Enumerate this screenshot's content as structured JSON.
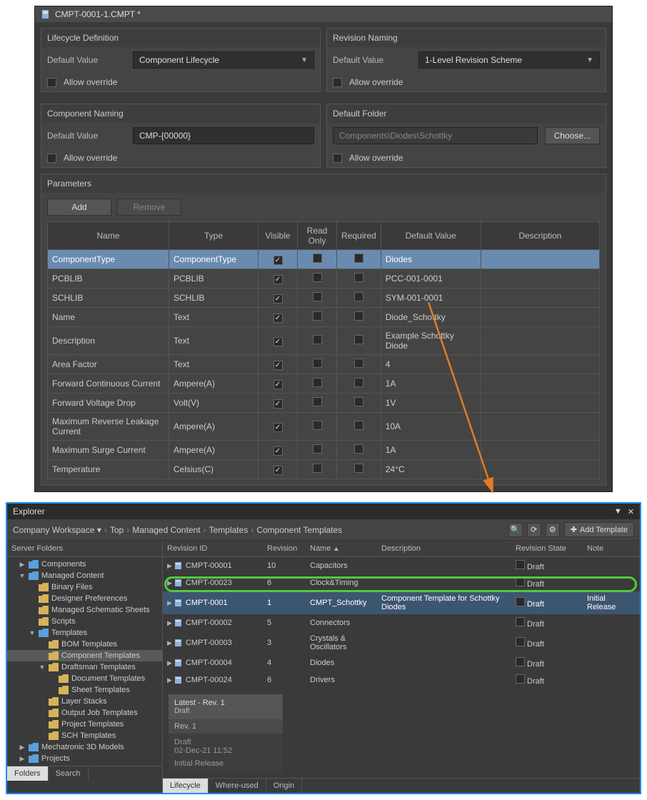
{
  "top": {
    "title": "CMPT-0001-1.CMPT *",
    "lifecycle": {
      "header": "Lifecycle Definition",
      "default_label": "Default Value",
      "default_value": "Component Lifecycle",
      "override_label": "Allow override"
    },
    "revision": {
      "header": "Revision Naming",
      "default_label": "Default Value",
      "default_value": "1-Level Revision Scheme",
      "override_label": "Allow override"
    },
    "component_naming": {
      "header": "Component Naming",
      "default_label": "Default Value",
      "default_value": "CMP-{00000}",
      "override_label": "Allow override"
    },
    "default_folder": {
      "header": "Default Folder",
      "path": "Components\\Diodes\\Schottky",
      "choose": "Choose...",
      "override_label": "Allow override"
    },
    "parameters": {
      "header": "Parameters",
      "add": "Add",
      "remove": "Remove",
      "cols": {
        "name": "Name",
        "type": "Type",
        "visible": "Visible",
        "readonly": "Read Only",
        "required": "Required",
        "default": "Default Value",
        "desc": "Description"
      },
      "rows": [
        {
          "name": "ComponentType",
          "type": "ComponentType",
          "visible": true,
          "readonly": false,
          "required": false,
          "default": "Diodes",
          "desc": "",
          "selected": true
        },
        {
          "name": "PCBLIB",
          "type": "PCBLIB",
          "visible": true,
          "readonly": false,
          "required": false,
          "default": "PCC-001-0001",
          "desc": ""
        },
        {
          "name": "SCHLIB",
          "type": "SCHLIB",
          "visible": true,
          "readonly": false,
          "required": false,
          "default": "SYM-001-0001",
          "desc": ""
        },
        {
          "name": "Name",
          "type": "Text",
          "visible": true,
          "readonly": false,
          "required": false,
          "default": "Diode_Schottky",
          "desc": ""
        },
        {
          "name": "Description",
          "type": "Text",
          "visible": true,
          "readonly": false,
          "required": false,
          "default": "Example Schottky Diode",
          "desc": ""
        },
        {
          "name": "Area Factor",
          "type": "Text",
          "visible": true,
          "readonly": false,
          "required": false,
          "default": "4",
          "desc": ""
        },
        {
          "name": "Forward Continuous Current",
          "type": "Ampere(A)",
          "visible": true,
          "readonly": false,
          "required": false,
          "default": "1A",
          "desc": ""
        },
        {
          "name": "Forward Voltage Drop",
          "type": "Volt(V)",
          "visible": true,
          "readonly": false,
          "required": false,
          "default": "1V",
          "desc": ""
        },
        {
          "name": "Maximum Reverse Leakage Current",
          "type": "Ampere(A)",
          "visible": true,
          "readonly": false,
          "required": false,
          "default": "10A",
          "desc": ""
        },
        {
          "name": "Maximum Surge Current",
          "type": "Ampere(A)",
          "visible": true,
          "readonly": false,
          "required": false,
          "default": "1A",
          "desc": ""
        },
        {
          "name": "Temperature",
          "type": "Celsius(C)",
          "visible": true,
          "readonly": false,
          "required": false,
          "default": "24°C",
          "desc": ""
        }
      ]
    }
  },
  "explorer": {
    "title": "Explorer",
    "breadcrumb": [
      "Company Workspace",
      "Top",
      "Managed Content",
      "Templates",
      "Component Templates"
    ],
    "toolbar": {
      "add_template": "Add Template"
    },
    "tree": {
      "header": "Server Folders",
      "items": [
        {
          "label": "Components",
          "level": 1,
          "exp": "▶",
          "color": "#5aa0e0"
        },
        {
          "label": "Managed Content",
          "level": 1,
          "exp": "▼",
          "color": "#5aa0e0"
        },
        {
          "label": "Binary Files",
          "level": 2,
          "exp": "",
          "color": "#d6b25a"
        },
        {
          "label": "Designer Preferences",
          "level": 2,
          "exp": "",
          "color": "#d6b25a"
        },
        {
          "label": "Managed Schematic Sheets",
          "level": 2,
          "exp": "",
          "color": "#d6b25a"
        },
        {
          "label": "Scripts",
          "level": 2,
          "exp": "",
          "color": "#d6b25a"
        },
        {
          "label": "Templates",
          "level": 2,
          "exp": "▼",
          "color": "#5aa0e0"
        },
        {
          "label": "BOM Templates",
          "level": 3,
          "exp": "",
          "color": "#d6b25a"
        },
        {
          "label": "Component Templates",
          "level": 3,
          "exp": "",
          "color": "#d6b25a",
          "selected": true
        },
        {
          "label": "Draftsman Templates",
          "level": 3,
          "exp": "▼",
          "color": "#d6b25a"
        },
        {
          "label": "Document Templates",
          "level": 4,
          "exp": "",
          "color": "#d6b25a"
        },
        {
          "label": "Sheet Templates",
          "level": 4,
          "exp": "",
          "color": "#d6b25a"
        },
        {
          "label": "Layer Stacks",
          "level": 3,
          "exp": "",
          "color": "#d6b25a"
        },
        {
          "label": "Output Job Templates",
          "level": 3,
          "exp": "",
          "color": "#d6b25a"
        },
        {
          "label": "Project Templates",
          "level": 3,
          "exp": "",
          "color": "#d6b25a"
        },
        {
          "label": "SCH Templates",
          "level": 3,
          "exp": "",
          "color": "#d6b25a"
        },
        {
          "label": "Mechatronic 3D Models",
          "level": 1,
          "exp": "▶",
          "color": "#5aa0e0"
        },
        {
          "label": "Projects",
          "level": 1,
          "exp": "▶",
          "color": "#5aa0e0"
        }
      ],
      "tabs": [
        "Folders",
        "Search"
      ]
    },
    "list": {
      "cols": {
        "rev_id": "Revision ID",
        "rev": "Revision",
        "name": "Name",
        "desc": "Description",
        "state": "Revision State",
        "note": "Note"
      },
      "rows": [
        {
          "rev_id": "CMPT-00001",
          "rev": "10",
          "name": "Capacitors",
          "desc": "",
          "state": "Draft",
          "note": ""
        },
        {
          "rev_id": "CMPT-00023",
          "rev": "6",
          "name": "Clock&Timing",
          "desc": "",
          "state": "Draft",
          "note": ""
        },
        {
          "rev_id": "CMPT-0001",
          "rev": "1",
          "name": "CMPT_Schottky",
          "desc": "Component Template for Schottky Diodes",
          "state": "Draft",
          "note": "Initial Release",
          "highlight": true
        },
        {
          "rev_id": "CMPT-00002",
          "rev": "5",
          "name": "Connectors",
          "desc": "",
          "state": "Draft",
          "note": ""
        },
        {
          "rev_id": "CMPT-00003",
          "rev": "3",
          "name": "Crystals & Oscillators",
          "desc": "",
          "state": "Draft",
          "note": ""
        },
        {
          "rev_id": "CMPT-00004",
          "rev": "4",
          "name": "Diodes",
          "desc": "",
          "state": "Draft",
          "note": ""
        },
        {
          "rev_id": "CMPT-00024",
          "rev": "6",
          "name": "Drivers",
          "desc": "",
          "state": "Draft",
          "note": ""
        }
      ]
    },
    "detail": {
      "head": "Latest - Rev.  1",
      "head_sub": "Draft",
      "sub": "Rev. 1",
      "body1": "Draft",
      "body2": "02-Dec-21 11:52",
      "body3": "Initial Release"
    },
    "bottom_tabs": [
      "Lifecycle",
      "Where-used",
      "Origin"
    ]
  }
}
